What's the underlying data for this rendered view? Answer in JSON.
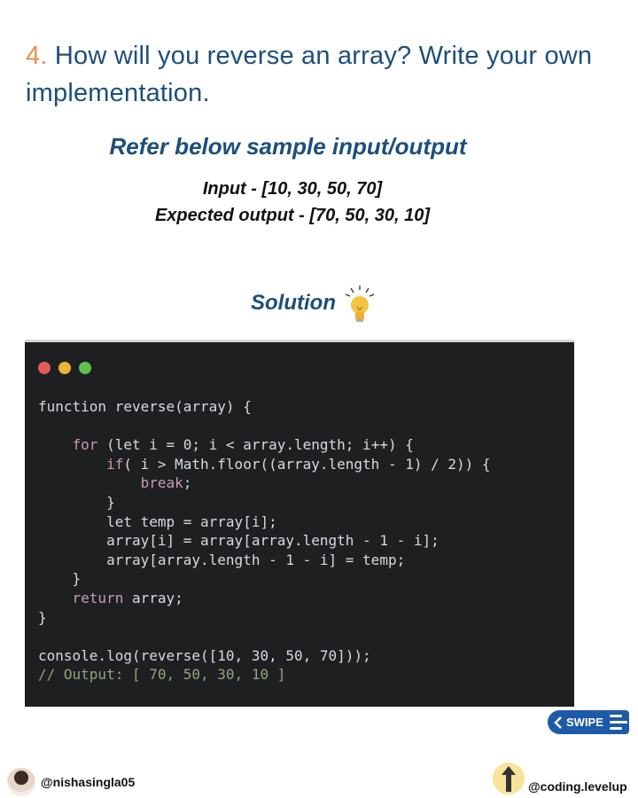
{
  "question": {
    "number": "4.",
    "text": "How will you reverse an array? Write your own implementation."
  },
  "refer": "Refer below sample input/output",
  "input": "Input - [10, 30, 50, 70]",
  "expected": "Expected output - [70, 50, 30, 10]",
  "solution": "Solution",
  "window_dots": [
    "#e25b5b",
    "#e8b53a",
    "#5cc24a"
  ],
  "code_lines": [
    [
      {
        "t": "function reverse(array) {"
      }
    ],
    [],
    [
      {
        "t": "    "
      },
      {
        "t": "for",
        "k": 1
      },
      {
        "t": " (let i = 0; i < array.length; i++) {"
      }
    ],
    [
      {
        "t": "        "
      },
      {
        "t": "if",
        "k": 1
      },
      {
        "t": "( i > Math.floor((array.length - 1) / 2)) {"
      }
    ],
    [
      {
        "t": "            "
      },
      {
        "t": "break",
        "k": 1
      },
      {
        "t": ";"
      }
    ],
    [
      {
        "t": "        }"
      }
    ],
    [
      {
        "t": "        let temp = array[i];"
      }
    ],
    [
      {
        "t": "        array[i] = array[array.length - 1 - i];"
      }
    ],
    [
      {
        "t": "        array[array.length - 1 - i] = temp;"
      }
    ],
    [
      {
        "t": "    }"
      }
    ],
    [
      {
        "t": "    "
      },
      {
        "t": "return",
        "k": 1
      },
      {
        "t": " array;"
      }
    ],
    [
      {
        "t": "}"
      }
    ],
    [],
    [
      {
        "t": "console.log(reverse([10, 30, 50, 70]));"
      }
    ],
    [
      {
        "t": "// Output: [ 70, 50, 30, 10 ]",
        "c": 1
      }
    ]
  ],
  "swipe": "SWIPE",
  "author_handle": "@nishasingla05",
  "brand_handle": "@coding.levelup"
}
